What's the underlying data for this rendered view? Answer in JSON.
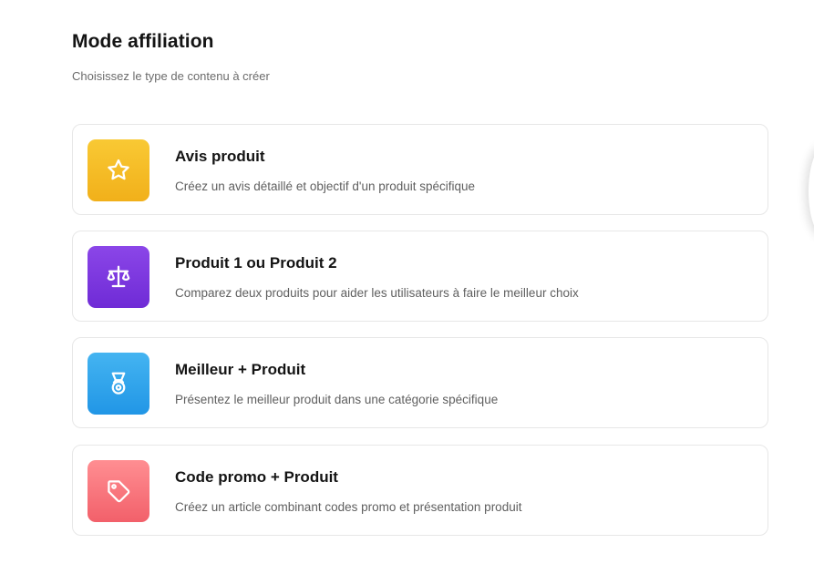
{
  "header": {
    "title": "Mode affiliation",
    "subtitle": "Choisissez le type de contenu à créer"
  },
  "options": [
    {
      "title": "Avis produit",
      "description": "Créez un avis détaillé et objectif d'un produit spécifique",
      "icon": "star-icon",
      "color_from": "#f9c934",
      "color_to": "#f1b01a"
    },
    {
      "title": "Produit 1 ou Produit 2",
      "description": "Comparez deux produits pour aider les utilisateurs à faire le meilleur choix",
      "icon": "scale-icon",
      "color_from": "#8b46e8",
      "color_to": "#6f2bd6"
    },
    {
      "title": "Meilleur + Produit",
      "description": "Présentez le meilleur produit dans une catégorie spécifique",
      "icon": "medal-icon",
      "color_from": "#44b4f1",
      "color_to": "#2196e6"
    },
    {
      "title": "Code promo + Produit",
      "description": "Créez un article combinant codes promo et présentation produit",
      "icon": "tag-icon",
      "color_from": "#ff8e92",
      "color_to": "#f2606a"
    }
  ]
}
